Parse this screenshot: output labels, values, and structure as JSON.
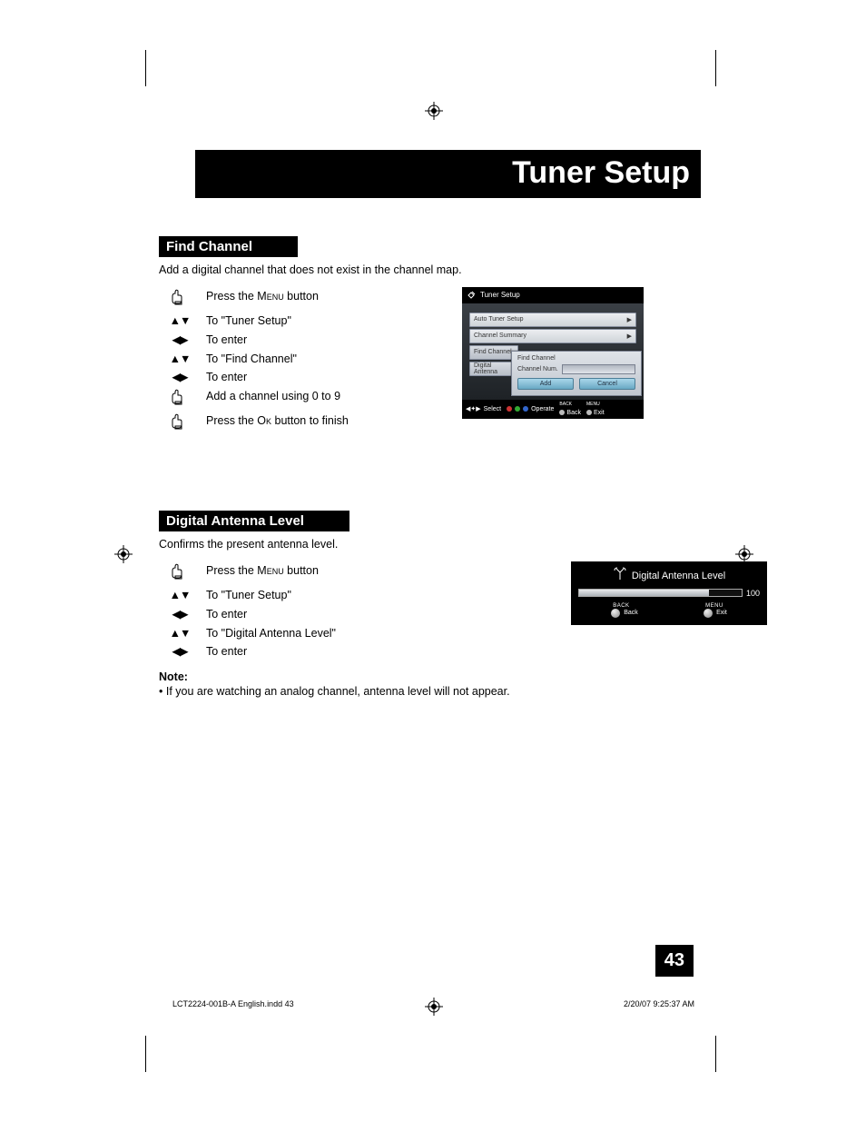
{
  "page_title": "Tuner Setup",
  "page_number": "43",
  "footer": {
    "doc": "LCT2224-001B-A English.indd   43",
    "date": "2/20/07   9:25:37 AM"
  },
  "sections": {
    "find_channel": {
      "heading": "Find Channel",
      "desc": "Add a digital channel that does not exist in the channel map.",
      "steps": [
        {
          "icon": "hand",
          "text_pre": "Press the ",
          "smallcaps": "Menu",
          "text_post": " button"
        },
        {
          "icon": "updown",
          "text": "To \"Tuner Setup\""
        },
        {
          "icon": "leftright",
          "text": "To enter"
        },
        {
          "icon": "updown",
          "text": "To \"Find Channel\""
        },
        {
          "icon": "leftright",
          "text": "To enter"
        },
        {
          "icon": "hand",
          "text": "Add a channel using 0 to 9"
        },
        {
          "icon": "hand",
          "text_pre": "Press the ",
          "smallcaps": "Ok",
          "text_post": " button to finish"
        }
      ]
    },
    "antenna": {
      "heading": "Digital Antenna Level",
      "desc": "Confirms the present antenna level.",
      "steps": [
        {
          "icon": "hand",
          "text_pre": "Press the ",
          "smallcaps": "Menu",
          "text_post": " button"
        },
        {
          "icon": "updown",
          "text": "To \"Tuner Setup\""
        },
        {
          "icon": "leftright",
          "text": "To enter"
        },
        {
          "icon": "updown",
          "text": "To \"Digital Antenna Level\""
        },
        {
          "icon": "leftright",
          "text": "To enter"
        }
      ],
      "note_label": "Note:",
      "note_body": "•  If you are watching an analog channel, antenna level will not appear."
    }
  },
  "osd_tuner": {
    "title": "Tuner Setup",
    "rows": [
      "Auto Tuner Setup",
      "Channel Summary",
      "Find Channel",
      "Digital Antenna"
    ],
    "popup": {
      "title": "Find Channel",
      "field_label": "Channel Num.",
      "btn_add": "Add",
      "btn_cancel": "Cancel"
    },
    "footer": {
      "select": "Select",
      "operate": "Operate",
      "back_top": "BACK",
      "back": "Back",
      "exit_top": "MENU",
      "exit": "Exit"
    }
  },
  "osd_antenna": {
    "title": "Digital Antenna Level",
    "value": "100",
    "back_top": "BACK",
    "back": "Back",
    "menu_top": "MENU",
    "exit": "Exit"
  },
  "glyphs": {
    "updown": "▲▼",
    "leftright": "◀▶",
    "right_small": "▶"
  }
}
